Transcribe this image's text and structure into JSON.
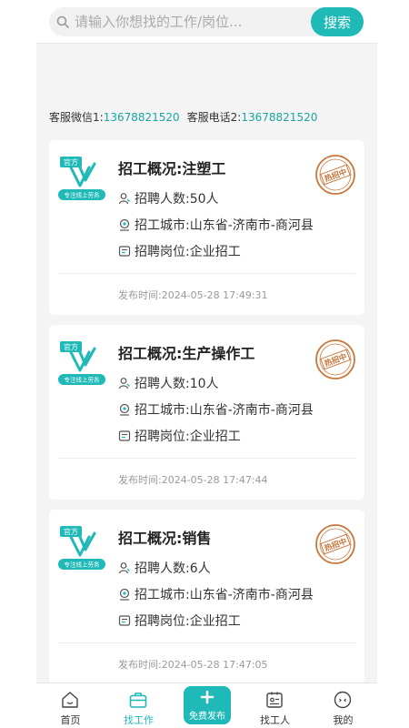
{
  "search": {
    "placeholder": "请输入你想找的工作/岗位...",
    "button_label": "搜索"
  },
  "contact": {
    "wechat_label": "客服微信1:",
    "wechat_value": "13678821520",
    "phone_label": "客服电话2:",
    "phone_value": "13678821520"
  },
  "jobs": [
    {
      "logo_text": "官方",
      "logo_sub": "专注线上劳务",
      "stamp": "热招中",
      "title": "招工概况:注塑工",
      "count_label": "招聘人数:",
      "count": "50人",
      "city_label": "招工城市:",
      "city": "山东省-济南市-商河县",
      "post_label": "招聘岗位:",
      "post": "企业招工",
      "time": "发布时间:2024-05-28 17:49:31"
    },
    {
      "logo_text": "官方",
      "logo_sub": "专注线上劳务",
      "stamp": "热招中",
      "title": "招工概况:生产操作工",
      "count_label": "招聘人数:",
      "count": "10人",
      "city_label": "招工城市:",
      "city": "山东省-济南市-商河县",
      "post_label": "招聘岗位:",
      "post": "企业招工",
      "time": "发布时间:2024-05-28 17:47:44"
    },
    {
      "logo_text": "官方",
      "logo_sub": "专注线上劳务",
      "stamp": "热招中",
      "title": "招工概况:销售",
      "count_label": "招聘人数:",
      "count": "6人",
      "city_label": "招工城市:",
      "city": "山东省-济南市-商河县",
      "post_label": "招聘岗位:",
      "post": "企业招工",
      "time": "发布时间:2024-05-28 17:47:05"
    }
  ],
  "nav": {
    "home": "首页",
    "find_job": "找工作",
    "publish": "免费发布",
    "find_worker": "找工人",
    "mine": "我的"
  },
  "colors": {
    "accent": "#1fb9b7",
    "stamp": "#c8763a",
    "link": "#1aa6a4"
  },
  "icons": {
    "search": "search-icon",
    "person": "person-icon",
    "location": "location-pin-icon",
    "post": "id-card-icon",
    "home": "home-icon",
    "briefcase": "briefcase-icon",
    "plus": "plus-icon",
    "worker": "worker-card-icon",
    "mine": "face-icon"
  }
}
